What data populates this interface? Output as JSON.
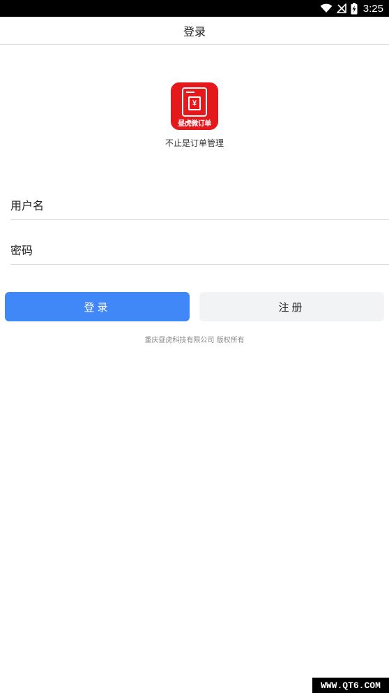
{
  "status_bar": {
    "time": "3:25",
    "icons": [
      "wifi-icon",
      "no-signal-icon",
      "battery-charging-icon"
    ]
  },
  "header": {
    "title": "登录"
  },
  "logo": {
    "currency_symbol": "¥",
    "app_name": "昼虎微订单",
    "slogan": "不止是订单管理"
  },
  "form": {
    "username_placeholder": "用户名",
    "password_placeholder": "密码"
  },
  "buttons": {
    "login_label": "登录",
    "register_label": "注册"
  },
  "footer": {
    "copyright": "重庆昼虎科技有限公司 版权所有"
  },
  "watermark": "WWW.QT6.COM",
  "colors": {
    "primary": "#4088f8",
    "logo_red": "#e5191c",
    "secondary_button": "#f2f3f5"
  }
}
